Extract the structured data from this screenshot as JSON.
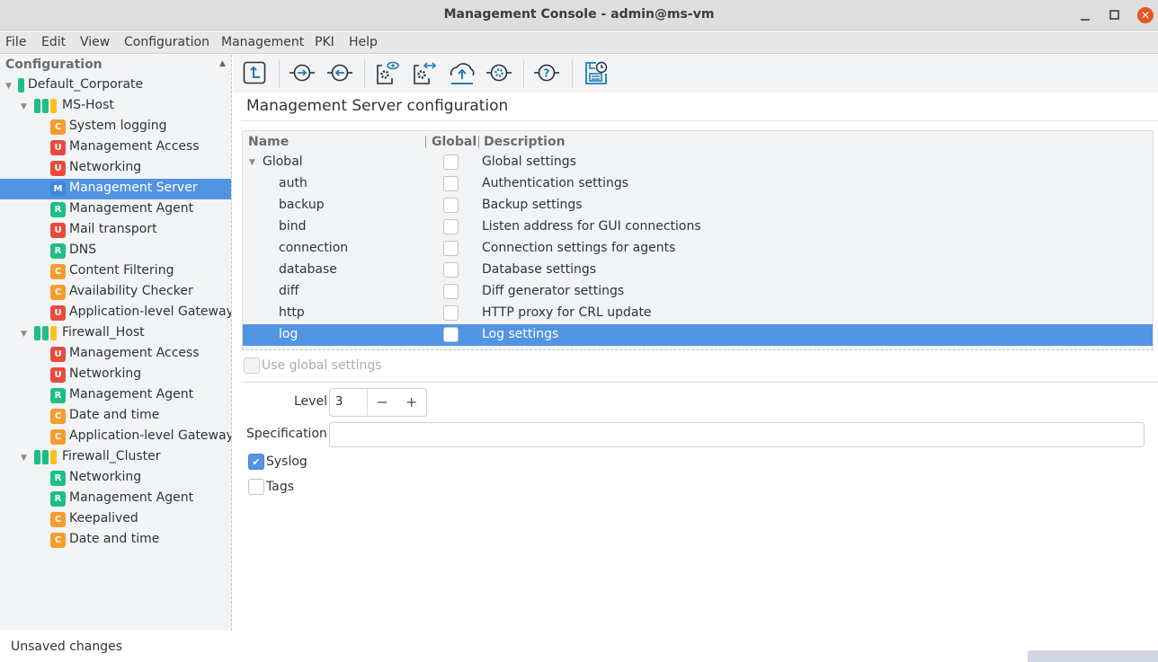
{
  "window": {
    "title": "Management Console - admin@ms-vm",
    "minimize_icon": "minimize-icon",
    "maximize_icon": "maximize-icon",
    "close_icon": "close-icon",
    "close_glyph": "✕"
  },
  "menu": [
    "File",
    "Edit",
    "View",
    "Configuration",
    "Management",
    "PKI",
    "Help"
  ],
  "sidebar": {
    "header": "Configuration",
    "sort_glyph": "▲",
    "tree": [
      {
        "level": 0,
        "label": "Default_Corporate",
        "type": "group",
        "bars": [
          "#1dbf85"
        ]
      },
      {
        "level": 1,
        "label": "MS-Host",
        "type": "host",
        "bars": [
          "#1dbf85",
          "#1dbf85",
          "#fcc21b"
        ]
      },
      {
        "level": 2,
        "label": "System logging",
        "badge": "C",
        "color": "#f49c2f"
      },
      {
        "level": 2,
        "label": "Management Access",
        "badge": "U",
        "color": "#e84b3c"
      },
      {
        "level": 2,
        "label": "Networking",
        "badge": "U",
        "color": "#e84b3c"
      },
      {
        "level": 2,
        "label": "Management Server",
        "badge": "M",
        "color": "#3d8ad8",
        "selected": true
      },
      {
        "level": 2,
        "label": "Management Agent",
        "badge": "R",
        "color": "#1dbf85"
      },
      {
        "level": 2,
        "label": "Mail transport",
        "badge": "U",
        "color": "#e84b3c"
      },
      {
        "level": 2,
        "label": "DNS",
        "badge": "R",
        "color": "#1dbf85"
      },
      {
        "level": 2,
        "label": "Content Filtering",
        "badge": "C",
        "color": "#f49c2f"
      },
      {
        "level": 2,
        "label": "Availability Checker",
        "badge": "C",
        "color": "#f49c2f"
      },
      {
        "level": 2,
        "label": "Application-level Gateway",
        "badge": "U",
        "color": "#e84b3c"
      },
      {
        "level": 1,
        "label": "Firewall_Host",
        "type": "host",
        "bars": [
          "#1dbf85",
          "#1dbf85",
          "#fcc21b"
        ]
      },
      {
        "level": 2,
        "label": "Management Access",
        "badge": "U",
        "color": "#e84b3c"
      },
      {
        "level": 2,
        "label": "Networking",
        "badge": "U",
        "color": "#e84b3c"
      },
      {
        "level": 2,
        "label": "Management Agent",
        "badge": "R",
        "color": "#1dbf85"
      },
      {
        "level": 2,
        "label": "Date and time",
        "badge": "C",
        "color": "#f49c2f"
      },
      {
        "level": 2,
        "label": "Application-level Gateway",
        "badge": "C",
        "color": "#f49c2f"
      },
      {
        "level": 1,
        "label": "Firewall_Cluster",
        "type": "host",
        "bars": [
          "#1dbf85",
          "#1dbf85",
          "#fcc21b"
        ]
      },
      {
        "level": 2,
        "label": "Networking",
        "badge": "R",
        "color": "#1dbf85"
      },
      {
        "level": 2,
        "label": "Management Agent",
        "badge": "R",
        "color": "#1dbf85"
      },
      {
        "level": 2,
        "label": "Keepalived",
        "badge": "C",
        "color": "#f49c2f"
      },
      {
        "level": 2,
        "label": "Date and time",
        "badge": "C",
        "color": "#f49c2f"
      }
    ]
  },
  "toolbar": {
    "buttons": [
      "go-up-icon",
      "connect-icon",
      "disconnect-icon",
      "view-config-icon",
      "compare-config-icon",
      "upload-icon",
      "settings-icon",
      "help-icon",
      "save-history-icon"
    ]
  },
  "main": {
    "title": "Management Server configuration",
    "table": {
      "columns": [
        "Name",
        "Global",
        "Description"
      ],
      "rows": [
        {
          "name": "Global",
          "global": false,
          "description": "Global settings",
          "group": true
        },
        {
          "name": "auth",
          "global": false,
          "description": "Authentication settings"
        },
        {
          "name": "backup",
          "global": false,
          "description": "Backup settings"
        },
        {
          "name": "bind",
          "global": false,
          "description": "Listen address for GUI connections"
        },
        {
          "name": "connection",
          "global": false,
          "description": "Connection settings for agents"
        },
        {
          "name": "database",
          "global": false,
          "description": "Database settings"
        },
        {
          "name": "diff",
          "global": false,
          "description": "Diff generator settings"
        },
        {
          "name": "http",
          "global": false,
          "description": "HTTP proxy for CRL update"
        },
        {
          "name": "log",
          "global": false,
          "description": "Log settings",
          "selected": true
        }
      ]
    },
    "use_global": {
      "label": "Use global settings",
      "checked": false,
      "disabled": true
    },
    "level": {
      "label": "Level",
      "value": "3",
      "minus": "−",
      "plus": "+"
    },
    "specification": {
      "label": "Specification",
      "value": ""
    },
    "syslog": {
      "label": "Syslog",
      "checked": true,
      "check_glyph": "✔"
    },
    "tags": {
      "label": "Tags",
      "checked": false
    }
  },
  "status": {
    "text": "Unsaved changes"
  }
}
